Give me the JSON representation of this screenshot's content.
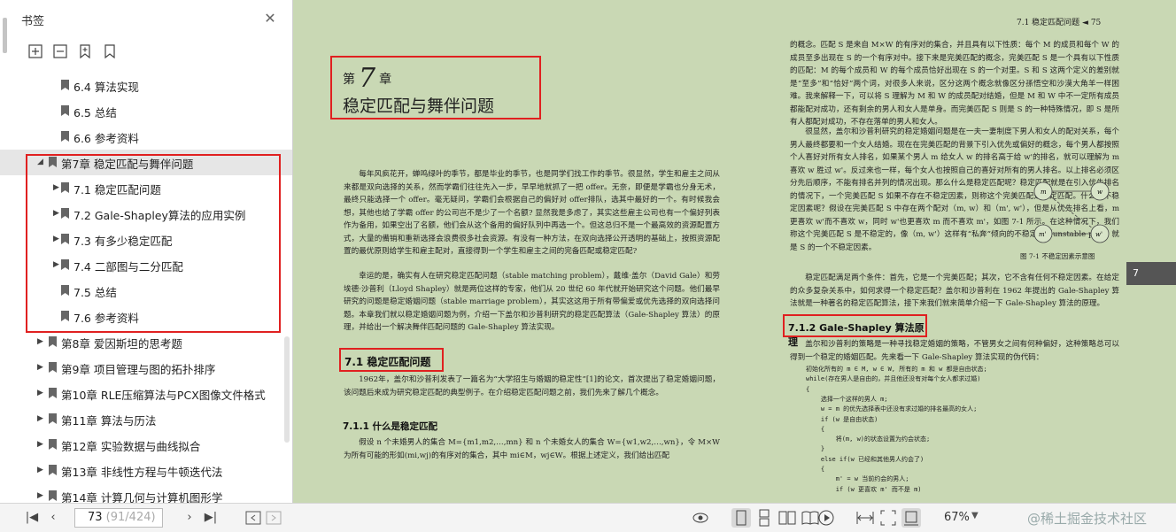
{
  "sidebar": {
    "title": "书签",
    "close_icon": "close-icon",
    "toolbar_icons": [
      "expand-bookmarks-icon",
      "collapse-bookmarks-icon",
      "add-bookmark-icon",
      "bookmark-icon"
    ],
    "items": [
      {
        "label": "6.4   算法实现",
        "level": 2,
        "arrow": false
      },
      {
        "label": "6.5   总结",
        "level": 2,
        "arrow": false
      },
      {
        "label": "6.6   参考资料",
        "level": 2,
        "arrow": false
      },
      {
        "label": "第7章    稳定匹配与舞伴问题",
        "level": 1,
        "arrow": "open"
      },
      {
        "label": "7.1    稳定匹配问题",
        "level": 2,
        "arrow": "closed"
      },
      {
        "label": "7.2    Gale-Shapley算法的应用实例",
        "level": 2,
        "arrow": "closed"
      },
      {
        "label": "7.3    有多少稳定匹配",
        "level": 2,
        "arrow": "closed"
      },
      {
        "label": "7.4    二部图与二分匹配",
        "level": 2,
        "arrow": "closed"
      },
      {
        "label": "7.5    总结",
        "level": 2,
        "arrow": false
      },
      {
        "label": "7.6    参考资料",
        "level": 2,
        "arrow": false
      },
      {
        "label": "第8章    爱因斯坦的思考题",
        "level": 1,
        "arrow": "closed"
      },
      {
        "label": "第9章    项目管理与图的拓扑排序",
        "level": 1,
        "arrow": "closed"
      },
      {
        "label": "第10章    RLE压缩算法与PCX图像文件格式",
        "level": 1,
        "arrow": "closed"
      },
      {
        "label": "第11章    算法与历法",
        "level": 1,
        "arrow": "closed"
      },
      {
        "label": "第12章    实验数据与曲线拟合",
        "level": 1,
        "arrow": "closed"
      },
      {
        "label": "第13章    非线性方程与牛顿迭代法",
        "level": 1,
        "arrow": "closed"
      },
      {
        "label": "第14章    计算几何与计算机图形学",
        "level": 1,
        "arrow": "closed"
      }
    ]
  },
  "bottombar": {
    "page_current": "73",
    "page_total": " (91/424)",
    "zoom": "67%",
    "watermark": "@稀土掘金技术社区"
  },
  "page_left": {
    "chapter_prefix": "第",
    "chapter_number": "7",
    "chapter_suffix": "章",
    "chapter_title": "稳定匹配与舞伴问题",
    "para1": "每年风疯花开，蝉鸣绿叶的季节，都是毕业的季节，也是同学们找工作的季节。很显然，学生和雇主之间从来都是双向选择的关系，然而学霸们往往先入一步，早早地就抓了一把 offer。无奈，即便是学霸也分身无术，最终只能选择一个 offer。毫无疑问，学霸们会根据自己的偏好对 offer排队，选其中最好的一个。有时候我会想，其他也给了学霸 offer 的公司岂不是少了一个名额? 显然我是多虑了，其实这些雇主公司也有一个偏好列表作为备用，如果空出了名额，他们会从这个备用的偏好队列中再选一个。但这总归不是一个最高效的资源配置方式，大量的備销和重新选择会浪费很多社会资源。有没有一种方法，在双向选择公开透明的基础上，按照资源配置的最优原则给学生和雇主配对，直接得到一个学生和雇主之间的完备匹配或稳定匹配?",
    "para2": "幸运的是，确实有人在研究稳定匹配问题（stable matching problem），戴维·盖尔（David Gale）和劳埃德·沙普利（Lloyd Shapley）就是两位这样的专家，他们从 20 世纪 60 年代就开始研究这个问题。他们最早研究的问题是稳定婚姻问题（stable marriage problem），其实这这用于所有带偏爱或优先选择的双向选择问题。本章我们就以稳定婚姻问题为例，介绍一下盖尔和沙普利研究的稳定匹配算法（Gale-Shapley 算法）的原理，并给出一个解决舞伴匹配问题的 Gale-Shapley 算法实现。",
    "section_title": "7.1   稳定匹配问题",
    "para3": "1962年，盖尔和沙普利发表了一篇名为“大学招生与婚姻的稳定性”[1]的论文，首次提出了稳定婚姻问题，该问题后来成为研究稳定匹配的典型例子。在介绍稳定匹配问题之前，我们先来了解几个概念。",
    "subsection_title": "7.1.1    什么是稳定匹配",
    "para4": "假设 n 个未婚男人的集合 M={m1,m2,…,mn} 和 n 个未婚女人的集合 W={w1,w2,…,wn}，令 M×W 为所有可能的形如(mi,wj)的有序对的集合，其中 mi∈M，wj∈W。根据上述定义，我们给出匹配"
  },
  "page_right": {
    "running_head": "7.1   稳定匹配问题   ◄   75",
    "para1": "的概念。匹配 S 是来自 M×W 的有序对的集合，并且具有以下性质：每个 M 的成员和每个 W 的成员至多出现在 S 的一个有序对中。接下来是完美匹配的概念，完美匹配 S 是一个具有以下性质的匹配：M 的每个成员和 W 的每个成员恰好出现在 S 的一个对里。S 和 S 这两个定义的差别就是“至多”和“恰好”两个词，对很多人来说，区分这两个概念就像区分孫悟空和沙漠大角羊一样困难。我来解释一下，可以将 S 理解为 M 和 W 的成员配对结婚，但是 M 和 W 中不一定所有成员都能配对成功，还有剩余的男人和女人是单身。而完美匹配 S 则是 S 的一种特殊情况，即 S 是所有人都配对成功，不存在落单的男人和女人。",
    "para2": "很显然，盖尔和沙普利研究的稳定婚姻问题是在一夫一妻制度下男人和女人的配对关系，每个男人最终都要和一个女人结婚。现在在完美匹配的背景下引入优先或偏好的概念，每个男人都按照个人喜好对所有女人排名，如果某个男人 m 给女人 w 的排名高于给 w'的排名，就可以理解为 m 喜欢 w 胜过 w'。反过来也一样，每个女人也按照自己的喜好对所有的男人排名。以上排名必须区分先后顺序，不能有排名并列的情况出现。那么什么是稳定匹配呢？稳定匹配就是在引入优先排名的情况下，一个完美匹配 S 如果不存在不稳定因素，则称这个完美匹配是稳定匹配。什么是不稳定因素呢？假设在完美匹配 S 中存在两个配对（m, w）和（m', w'），但是从优先排名上看，m 更喜欢 w'而不喜欢 w，同时 w'也更喜欢 m 而不喜欢 m'，如图 7-1 所示。在这种情况下，我们称这个完美匹配 S 是不稳定的，像（m, w'）这样有“私奔”倾向的不稳定对（unstable pair）就是 S 的一个不稳定因素。",
    "para3": "稳定匹配满足两个条件：首先，它是一个完美匹配；其次，它不含有任何不稳定因素。在给定的众多复杂关系中，如何求得一个稳定匹配？盖尔和沙普利在 1962 年提出的 Gale-Shapley 算法就是一种著名的稳定匹配算法，接下来我们就来简单介绍一下 Gale-Shapley 算法的原理。",
    "subsection_title": "7.1.2    Gale-Shapley 算法原理",
    "para4": "盖尔和沙普利的策略是一种寻找稳定婚姻的策略，不管男女之间有何种偏好，这种策略总可以得到一个稳定的婚姻匹配。先来看一下 Gale-Shapley 算法实现的伪代码：",
    "code": [
      "初始化所有的 m ∈ M, w ∈ W, 所有的 m 和 w 都是自由状态;",
      "while(存在男人是自由的，并且他还没有对每个女人都求过婚)",
      "{",
      "    选择一个这样的男人 m;",
      "    w = m 的优先选择表中还没有求过婚的排名最高的女人;",
      "    if (w 是自由状态)",
      "    {",
      "        将(m, w)的状态设置为约会状态;",
      "    }",
      "    else if(w 已经和其他男人约会了)",
      "    {",
      "        m' = w 当前约会的男人;",
      "        if (w 更喜欢 m' 而不是 m)"
    ],
    "figure_caption": "图 7-1    不稳定因素示意图",
    "figure_nodes": [
      "m",
      "w",
      "m'",
      "w'"
    ],
    "side_tab": "7"
  }
}
